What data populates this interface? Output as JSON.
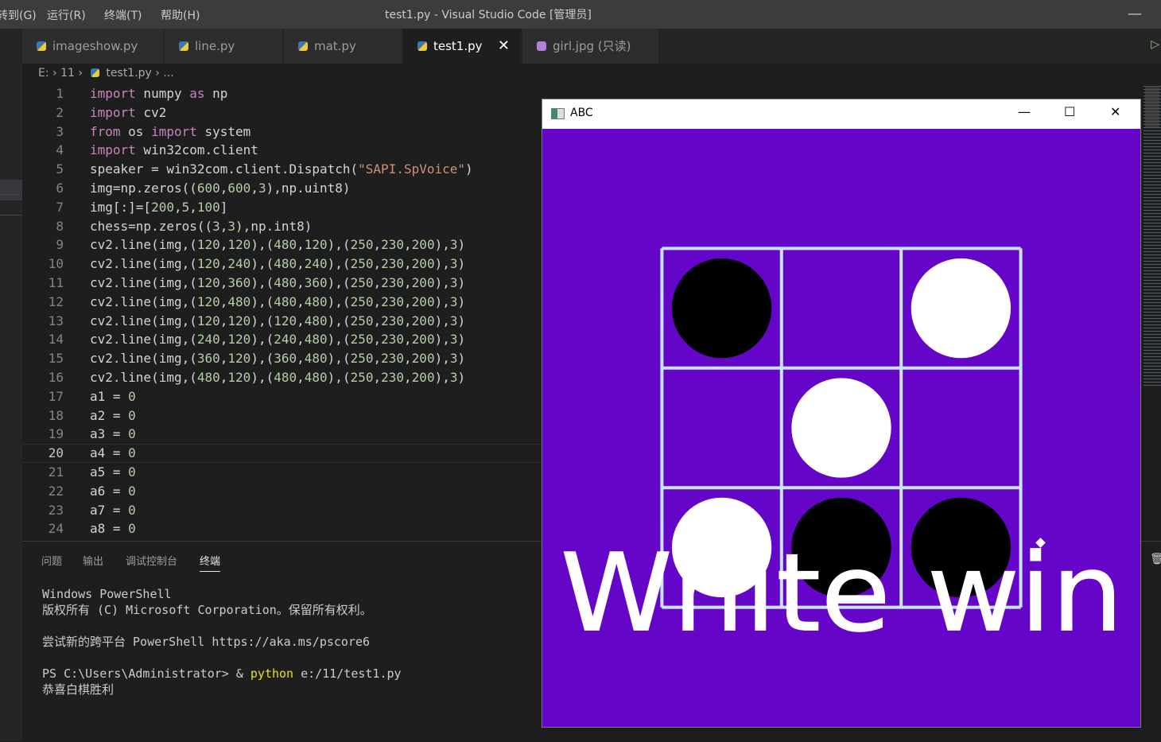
{
  "menubar": {
    "items": [
      "转到(G)",
      "运行(R)",
      "终端(T)",
      "帮助(H)"
    ]
  },
  "window_title": "test1.py - Visual Studio Code [管理员]",
  "tabs": [
    {
      "label": "imageshow.py",
      "active": false
    },
    {
      "label": "line.py",
      "active": false
    },
    {
      "label": "mat.py",
      "active": false
    },
    {
      "label": "test1.py",
      "active": true
    },
    {
      "label": "girl.jpg (只读)",
      "active": false
    }
  ],
  "breadcrumb": {
    "drive": "E:",
    "folder": "11",
    "file": "test1.py",
    "ellipsis": "..."
  },
  "code_lines": [
    {
      "n": "1",
      "t": "import numpy as np"
    },
    {
      "n": "2",
      "t": "import cv2"
    },
    {
      "n": "3",
      "t": "from os import system"
    },
    {
      "n": "4",
      "t": "import win32com.client"
    },
    {
      "n": "5",
      "t": "speaker = win32com.client.Dispatch(\"SAPI.SpVoice\")"
    },
    {
      "n": "6",
      "t": "img=np.zeros((600,600,3),np.uint8)"
    },
    {
      "n": "7",
      "t": "img[:]=[200,5,100]"
    },
    {
      "n": "8",
      "t": "chess=np.zeros((3,3),np.int8)"
    },
    {
      "n": "9",
      "t": "cv2.line(img,(120,120),(480,120),(250,230,200),3)"
    },
    {
      "n": "10",
      "t": "cv2.line(img,(120,240),(480,240),(250,230,200),3)"
    },
    {
      "n": "11",
      "t": "cv2.line(img,(120,360),(480,360),(250,230,200),3)"
    },
    {
      "n": "12",
      "t": "cv2.line(img,(120,480),(480,480),(250,230,200),3)"
    },
    {
      "n": "13",
      "t": "cv2.line(img,(120,120),(120,480),(250,230,200),3)"
    },
    {
      "n": "14",
      "t": "cv2.line(img,(240,120),(240,480),(250,230,200),3)"
    },
    {
      "n": "15",
      "t": "cv2.line(img,(360,120),(360,480),(250,230,200),3)"
    },
    {
      "n": "16",
      "t": "cv2.line(img,(480,120),(480,480),(250,230,200),3)"
    },
    {
      "n": "17",
      "t": "a1 = 0"
    },
    {
      "n": "18",
      "t": "a2 = 0"
    },
    {
      "n": "19",
      "t": "a3 = 0"
    },
    {
      "n": "20",
      "t": "a4 = 0"
    },
    {
      "n": "21",
      "t": "a5 = 0"
    },
    {
      "n": "22",
      "t": "a6 = 0"
    },
    {
      "n": "23",
      "t": "a7 = 0"
    },
    {
      "n": "24",
      "t": "a8 = 0"
    }
  ],
  "current_line": "20",
  "panel_tabs": [
    "问题",
    "输出",
    "调试控制台",
    "终端"
  ],
  "terminal": {
    "l1": "Windows PowerShell",
    "l2": "版权所有 (C) Microsoft Corporation。保留所有权利。",
    "l3": "尝试新的跨平台 PowerShell https://aka.ms/pscore6",
    "prompt": "PS C:\\Users\\Administrator> & ",
    "cmd": "python",
    "args": " e:/11/test1.py",
    "l5": "恭喜白棋胜利"
  },
  "cv_window": {
    "title": "ABC",
    "bg_color": "#6405c8",
    "line_color": "#c8e6fa",
    "board": [
      [
        "black",
        "empty",
        "white"
      ],
      [
        "empty",
        "white",
        "empty"
      ],
      [
        "white",
        "black",
        "black"
      ]
    ],
    "overlay_text": "White win"
  }
}
